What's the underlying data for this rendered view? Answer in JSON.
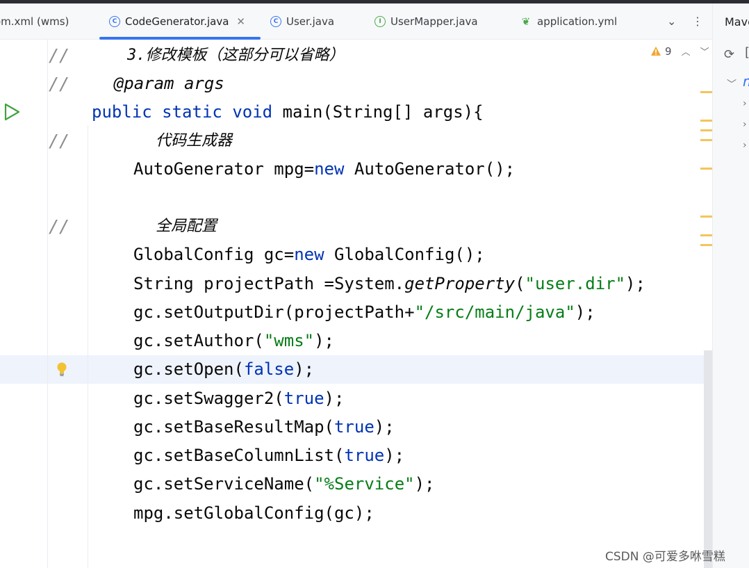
{
  "tabs": [
    {
      "label": "om.xml (wms)",
      "icon": "maven-file-icon"
    },
    {
      "label": "CodeGenerator.java",
      "icon": "class-icon",
      "active": true
    },
    {
      "label": "User.java",
      "icon": "class-icon"
    },
    {
      "label": "UserMapper.java",
      "icon": "interface-icon"
    },
    {
      "label": "application.yml",
      "icon": "spring-leaf-icon"
    }
  ],
  "tab_controls": {
    "more_tabs": "⌄",
    "options": "⋮"
  },
  "inspection": {
    "warning_count": "9"
  },
  "code": {
    "l1": {
      "prefix": "//",
      "text": "    3.修改模板（这部分可以省略）"
    },
    "l2": {
      "prefix": "//",
      "text": "    @param args"
    },
    "l3": {
      "public": "public",
      "static": "static",
      "void": "void",
      "rest": " main(String[] args){"
    },
    "l4": {
      "prefix": "//",
      "text": "代码生成器"
    },
    "l5": {
      "a": "AutoGenerator mpg=",
      "new": "new",
      "b": " AutoGenerator();"
    },
    "l6": {
      "prefix": "//",
      "text": "全局配置"
    },
    "l7": {
      "a": "GlobalConfig gc=",
      "new": "new",
      "b": " GlobalConfig();"
    },
    "l8": {
      "a": "String projectPath =System.",
      "method": "getProperty",
      "b": "(",
      "str": "\"user.dir\"",
      "c": ");"
    },
    "l9": {
      "a": "gc.setOutputDir(projectPath+",
      "str": "\"/src/main/java\"",
      "b": ");"
    },
    "l10": {
      "a": "gc.setAuthor(",
      "str": "\"wms\"",
      "b": ");"
    },
    "l11": {
      "a": "gc.setOpen(",
      "kw": "false",
      "b": ");"
    },
    "l12": {
      "a": "gc.setSwagger2(",
      "kw": "true",
      "b": ");"
    },
    "l13": {
      "a": "gc.setBaseResultMap(",
      "kw": "true",
      "b": ");"
    },
    "l14": {
      "a": "gc.setBaseColumnList(",
      "kw": "true",
      "b": ");"
    },
    "l15": {
      "a": "gc.setServiceName(",
      "str": "\"%Service\"",
      "b": ");"
    },
    "l16": {
      "a": "mpg.setGlobalConfig(gc);"
    }
  },
  "side_panel": {
    "title": "Maven",
    "root_item": "m"
  },
  "watermark": "CSDN @可爱多咻雪糕",
  "colors": {
    "keyword": "#0033b3",
    "string": "#067d17",
    "comment": "#8c8c8c",
    "accent": "#3574f0",
    "warning": "#f2c55c"
  }
}
